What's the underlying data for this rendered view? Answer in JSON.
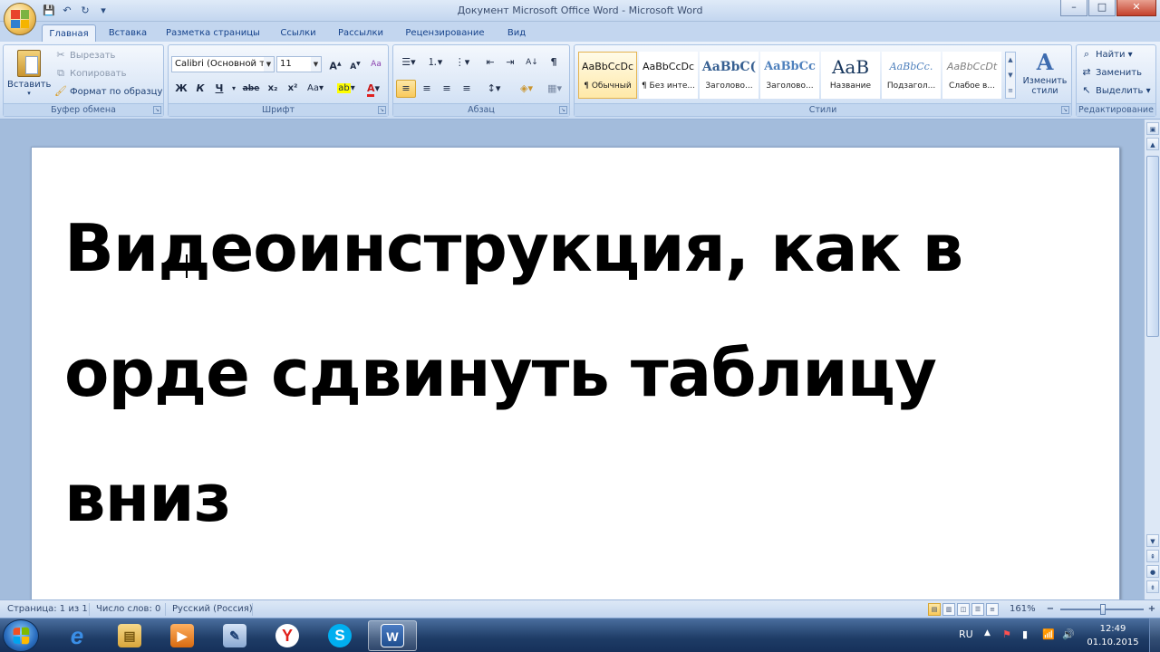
{
  "window": {
    "title": "Документ Microsoft Office Word - Microsoft Word",
    "minimize": "–",
    "maximize": "□",
    "close": "✕"
  },
  "qat": {
    "save": "💾",
    "undo": "↶",
    "redo": "↻",
    "more": "▾"
  },
  "tabs": [
    {
      "label": "Главная"
    },
    {
      "label": "Вставка"
    },
    {
      "label": "Разметка страницы"
    },
    {
      "label": "Ссылки"
    },
    {
      "label": "Рассылки"
    },
    {
      "label": "Рецензирование"
    },
    {
      "label": "Вид"
    }
  ],
  "ribbon": {
    "clipboard": {
      "label": "Буфер обмена",
      "paste": "Вставить",
      "cut": "Вырезать",
      "copy": "Копировать",
      "format_painter": "Формат по образцу"
    },
    "font": {
      "label": "Шрифт",
      "font_name": "Calibri (Основной те",
      "font_size": "11",
      "grow": "A",
      "shrink": "A",
      "clear": "Aa",
      "bold": "Ж",
      "italic": "К",
      "underline": "Ч",
      "strike": "abe",
      "subscript": "x₂",
      "superscript": "x²",
      "case": "Aa",
      "highlight": "ab",
      "font_color": "A"
    },
    "paragraph": {
      "label": "Абзац",
      "bullets": "☰",
      "numbering": "⒈",
      "multilevel": "⋮",
      "decrease_indent": "⇤",
      "increase_indent": "⇥",
      "sort": "А↓",
      "show_marks": "¶",
      "align_left": "≡",
      "align_center": "≡",
      "align_right": "≡",
      "justify": "≡",
      "line_spacing": "↕",
      "shading": "◈",
      "borders": "▦"
    },
    "styles": {
      "label": "Стили",
      "items": [
        {
          "sample": "AaBbCcDc",
          "name": "¶ Обычный"
        },
        {
          "sample": "AaBbCcDc",
          "name": "¶ Без инте..."
        },
        {
          "sample": "AaBbC(",
          "name": "Заголово..."
        },
        {
          "sample": "AaBbCc",
          "name": "Заголово..."
        },
        {
          "sample": "AaB",
          "name": "Название"
        },
        {
          "sample": "AaBbCc.",
          "name": "Подзагол..."
        },
        {
          "sample": "AaBbCcDt",
          "name": "Слабое в..."
        }
      ],
      "change_styles": "Изменить стили"
    },
    "editing": {
      "label": "Редактирование",
      "find": "Найти",
      "replace": "Заменить",
      "select": "Выделить"
    }
  },
  "document": {
    "text": "Видеоинструкция, как в орде сдвинуть таблицу вниз"
  },
  "statusbar": {
    "page": "Страница: 1 из 1",
    "words": "Число слов: 0",
    "language": "Русский (Россия)",
    "zoom": "161%",
    "zoom_out": "−",
    "zoom_in": "+"
  },
  "taskbar": {
    "apps": [
      {
        "name": "ie",
        "label": "e",
        "color": "#1f6fd0"
      },
      {
        "name": "explorer",
        "label": "▤",
        "color": "#e8b84a"
      },
      {
        "name": "media-player",
        "label": "▶",
        "color": "#e07a20"
      },
      {
        "name": "paint",
        "label": "✎",
        "color": "#5a7fb0"
      },
      {
        "name": "yandex",
        "label": "Y",
        "color": "#ffffff"
      },
      {
        "name": "skype",
        "label": "S",
        "color": "#00aff0"
      },
      {
        "name": "word",
        "label": "W",
        "color": "#2b5797"
      }
    ],
    "lang": "RU",
    "time": "12:49",
    "date": "01.10.2015"
  },
  "colors": {
    "accent": "#15428b",
    "ribbon": "#d5e3f5",
    "taskbar": "#1e3c66"
  }
}
